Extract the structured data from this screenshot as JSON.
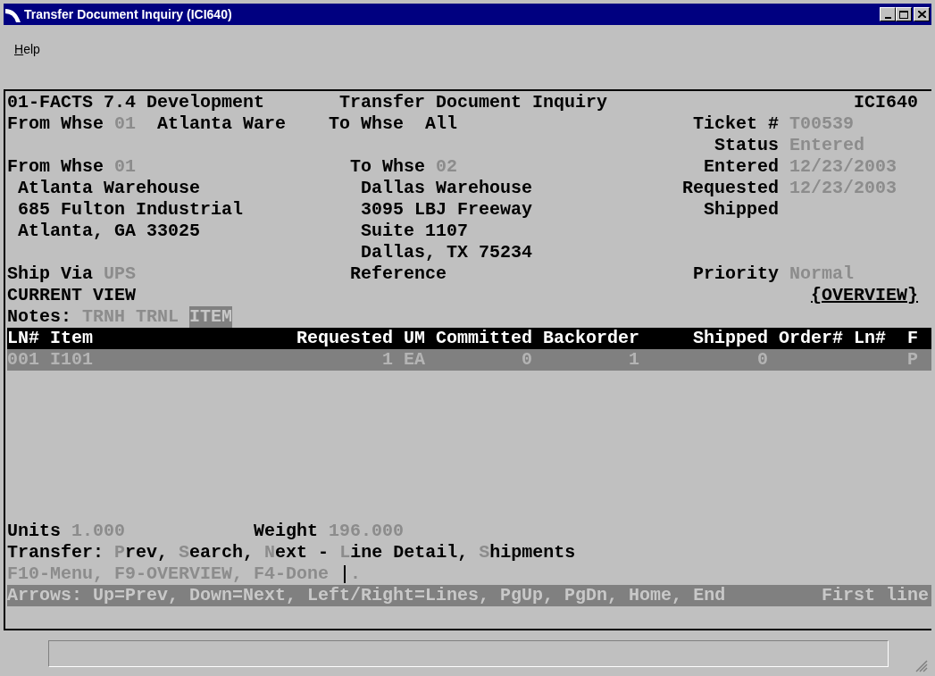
{
  "window": {
    "title": "Transfer Document Inquiry (ICI640)"
  },
  "menu": [
    {
      "label": "Help"
    }
  ],
  "screen": {
    "company": "01-FACTS 7.4 Development",
    "program_title": "Transfer Document Inquiry",
    "program_code": "ICI640",
    "filter": {
      "from_label": "From Whse",
      "from_code": "01",
      "from_name": "Atlanta Ware",
      "to_label": "To Whse",
      "to_value": "All"
    },
    "header_fields": [
      {
        "label": "Ticket #",
        "value": "T00539"
      },
      {
        "label": "Status",
        "value": "Entered"
      },
      {
        "label": "Entered",
        "value": "12/23/2003"
      },
      {
        "label": "Requested",
        "value": "12/23/2003"
      },
      {
        "label": "Shipped"
      }
    ],
    "from_warehouse": {
      "label": "From Whse",
      "code": "01",
      "address": [
        "Atlanta Warehouse",
        "685 Fulton Industrial",
        "Atlanta, GA 33025"
      ]
    },
    "to_warehouse": {
      "label": "To Whse",
      "code": "02",
      "address": [
        "Dallas Warehouse",
        "3095 LBJ Freeway",
        "Suite 1107",
        "Dallas, TX 75234"
      ]
    },
    "ship_via": {
      "label": "Ship Via",
      "value": "UPS"
    },
    "reference": {
      "label": "Reference"
    },
    "priority": {
      "label": "Priority",
      "value": "Normal"
    },
    "view_label": "CURRENT VIEW",
    "view_link": "{OVERVIEW}",
    "notes": {
      "label": "Notes:",
      "tags": [
        {
          "label": "TRNH",
          "selected": false
        },
        {
          "label": "TRNL",
          "selected": false
        },
        {
          "label": "ITEM",
          "selected": true
        }
      ]
    },
    "table": {
      "columns": [
        "LN#",
        "Item",
        "Requested",
        "UM",
        "Committed",
        "Backorder",
        "Shipped",
        "Order#",
        "Ln#",
        "F"
      ],
      "rows": [
        {
          "selected": true,
          "cells": [
            "001",
            "I101",
            "1",
            "EA",
            "0",
            "1",
            "0",
            null,
            null,
            "P"
          ]
        }
      ]
    },
    "totals": [
      {
        "label": "Units",
        "value": "1.000"
      },
      {
        "label": "Weight",
        "value": "196.000"
      }
    ],
    "command": {
      "label": "Transfer:",
      "options": [
        {
          "key": "P",
          "text": "rev,"
        },
        {
          "key": "S",
          "text": "earch,"
        },
        {
          "key": "N",
          "text": "ext -"
        },
        {
          "key": "L",
          "text": "ine Detail,"
        },
        {
          "key": "S",
          "text": "hipments"
        }
      ]
    },
    "function_keys": "F10-Menu, F9-OVERVIEW, F4-Done",
    "input_text": ".",
    "hint": "Arrows: Up=Prev, Down=Next, Left/Right=Lines, PgUp, PgDn, Home, End",
    "position": "First line"
  }
}
